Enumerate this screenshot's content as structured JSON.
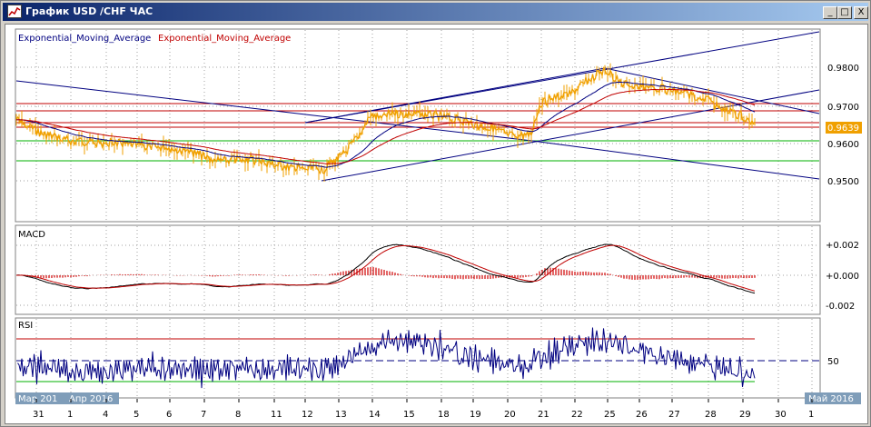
{
  "window": {
    "title": "График USD /CHF  ЧАС",
    "minimize_label": "_",
    "maximize_label": "□",
    "close_label": "X"
  },
  "legend": {
    "series1": "Exponential_Moving_Average",
    "series2": "Exponential_Moving_Average"
  },
  "price_axis": {
    "ticks": [
      "0.9800",
      "0.9700",
      "0.9600",
      "0.9500"
    ],
    "current": "0.9639"
  },
  "macd": {
    "label": "MACD",
    "ticks": [
      "+0.002",
      "+0.000",
      "-0.002"
    ]
  },
  "rsi": {
    "label": "RSI",
    "ticks": [
      "50"
    ]
  },
  "time_axis": {
    "days": [
      "31",
      "1",
      "4",
      "5",
      "6",
      "7",
      "8",
      "11",
      "12",
      "13",
      "14",
      "15",
      "18",
      "19",
      "20",
      "21",
      "22",
      "25",
      "26",
      "27",
      "28",
      "29",
      "30",
      "1"
    ],
    "month_left1": "Мар 201",
    "month_left2": "Апр 2016",
    "month_right": "Май 2016"
  },
  "colors": {
    "price": "#f0a000",
    "ema_fast": "#000080",
    "ema_slow": "#c00000",
    "hline_red": "#c00000",
    "hline_green": "#00b000",
    "trend": "#000080",
    "macd_hist": "#d00000",
    "rsi_line": "#000080",
    "rsi_over": "#e000e0",
    "title_blue": "#0a246a"
  }
}
